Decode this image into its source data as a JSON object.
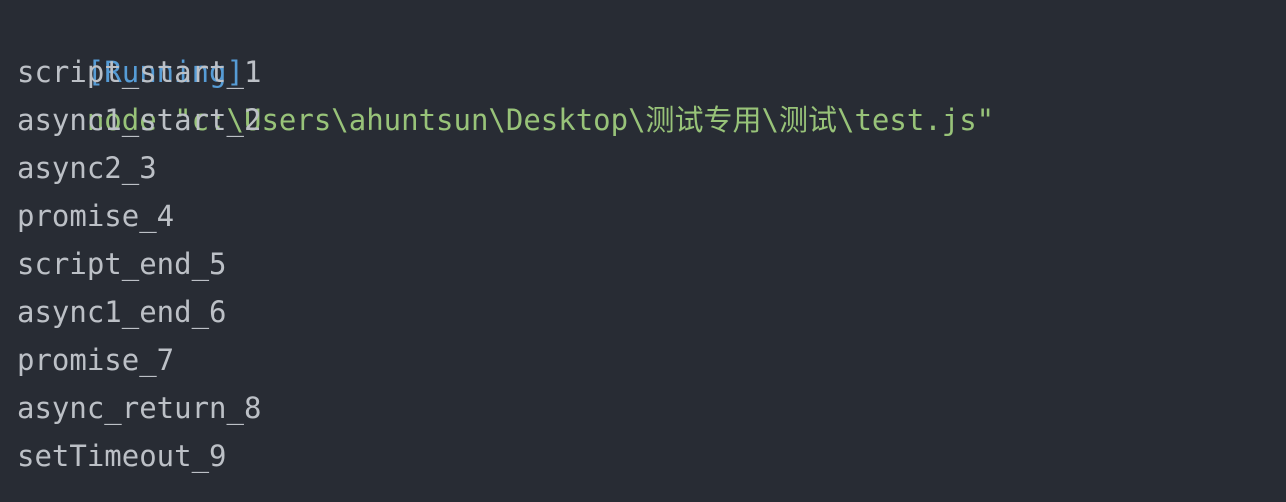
{
  "colors": {
    "background": "#282c34",
    "status": "#569cd6",
    "command": "#98c379",
    "output": "#bcc0c6"
  },
  "header": {
    "status": "[Running]",
    "command": "node \"c:\\Users\\ahuntsun\\Desktop\\测试专用\\测试\\test.js\""
  },
  "output": {
    "lines": [
      "script_start_1",
      "async1_start_2",
      "async2_3",
      "promise_4",
      "script_end_5",
      "async1_end_6",
      "promise_7",
      "async_return_8",
      "setTimeout_9"
    ]
  }
}
